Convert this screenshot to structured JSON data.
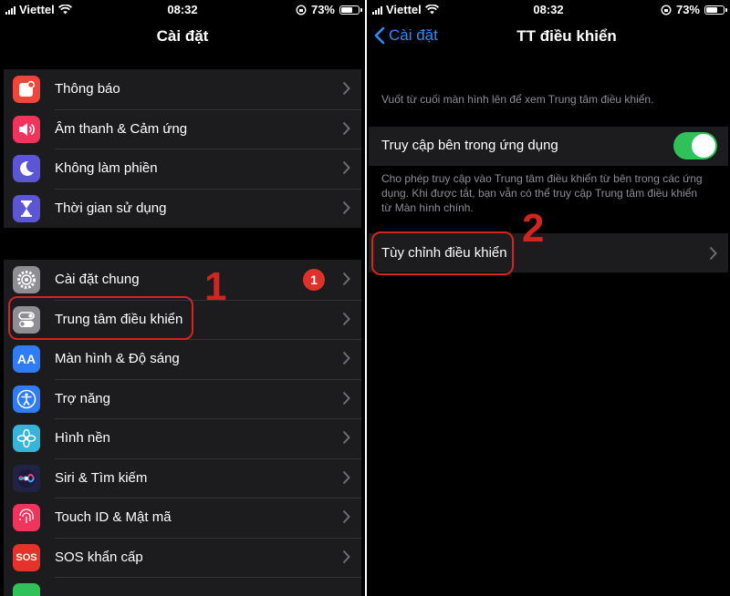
{
  "left": {
    "status": {
      "carrier": "Viettel",
      "time": "08:32",
      "battery": "73%",
      "battery_level": 0.73
    },
    "title": "Cài đặt",
    "group1": [
      {
        "label": "Thông báo",
        "icon": "notification-icon",
        "color": "#f0453a"
      },
      {
        "label": "Âm thanh & Cảm ứng",
        "icon": "speaker-icon",
        "color": "#f0345c"
      },
      {
        "label": "Không làm phiền",
        "icon": "moon-icon",
        "color": "#5b56d6"
      },
      {
        "label": "Thời gian sử dụng",
        "icon": "hourglass-icon",
        "color": "#5b56d6"
      }
    ],
    "group2": [
      {
        "label": "Cài đặt chung",
        "icon": "gear-icon",
        "color": "#8e8e93",
        "badge": "1"
      },
      {
        "label": "Trung tâm điều khiển",
        "icon": "toggles-icon",
        "color": "#8e8e93"
      },
      {
        "label": "Màn hình & Độ sáng",
        "icon": "aa-icon",
        "color": "#2f7cf6",
        "icon_text": "AA"
      },
      {
        "label": "Trợ năng",
        "icon": "accessibility-icon",
        "color": "#2f7cf6"
      },
      {
        "label": "Hình nền",
        "icon": "flower-icon",
        "color": "#36b5d9"
      },
      {
        "label": "Siri & Tìm kiếm",
        "icon": "siri-icon",
        "color": "#222244"
      },
      {
        "label": "Touch ID & Mật mã",
        "icon": "fingerprint-icon",
        "color": "#f0345c"
      },
      {
        "label": "SOS khẩn cấp",
        "icon": "sos-icon",
        "color": "#e5332a",
        "icon_text": "SOS"
      }
    ],
    "step": "1"
  },
  "right": {
    "status": {
      "carrier": "Viettel",
      "time": "08:32",
      "battery": "73%",
      "battery_level": 0.73
    },
    "back_label": "Cài đặt",
    "title": "TT điều khiển",
    "intro": "Vuốt từ cuối màn hình lên để xem Trung tâm điều khiển.",
    "toggle_label": "Truy cập bên trong ứng dụng",
    "toggle_on": true,
    "toggle_note": "Cho phép truy cập vào Trung tâm điều khiển từ bên trong các ứng dụng. Khi được tắt, bạn vẫn có thể truy cập Trung tâm điều khiển từ Màn hình chính.",
    "customize_label": "Tùy chỉnh điều khiển",
    "step": "2"
  },
  "colors": {
    "accent": "#2f8cff",
    "callout": "#d1251f",
    "toggle_on": "#30c259"
  }
}
